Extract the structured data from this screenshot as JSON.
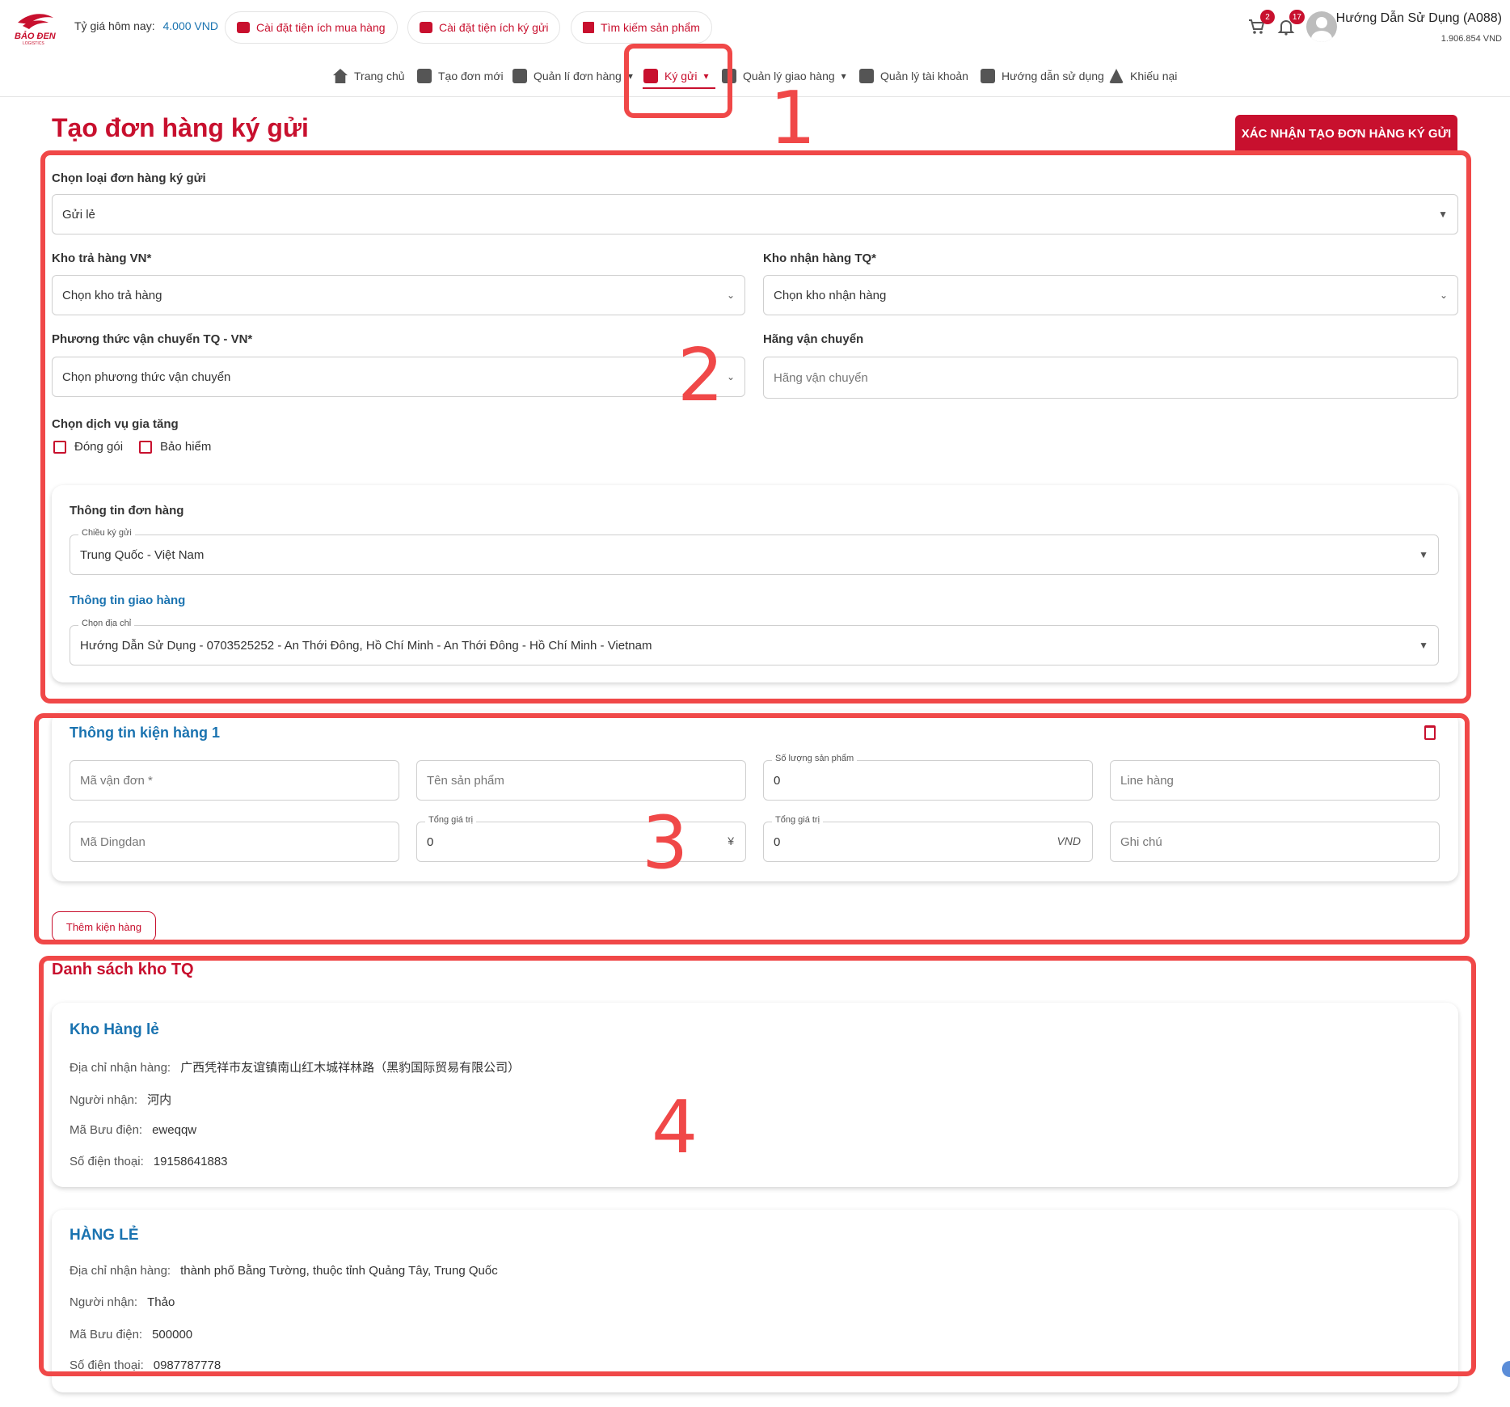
{
  "header": {
    "rate_label": "Tỷ giá hôm nay:",
    "rate_value": "4.000 VND",
    "pills": [
      {
        "label": "Cài đặt tiện ích mua hàng"
      },
      {
        "label": "Cài đặt tiện ích ký gửi"
      },
      {
        "label": "Tìm kiếm sản phẩm"
      }
    ],
    "cart_count": "2",
    "notif_count": "17",
    "user_name": "Hướng Dẫn Sử Dụng (A088)",
    "user_balance": "1.906.854 VND"
  },
  "nav": {
    "items": [
      {
        "label": "Trang chủ",
        "icon": "home-icon"
      },
      {
        "label": "Tạo đơn mới",
        "icon": "plus-square-icon"
      },
      {
        "label": "Quản lí đơn hàng",
        "icon": "cart-icon"
      },
      {
        "label": "Ký gửi",
        "icon": "box-icon"
      },
      {
        "label": "Quản lý giao hàng",
        "icon": "truck-icon"
      },
      {
        "label": "Quản lý tài khoản",
        "icon": "account-icon"
      },
      {
        "label": "Hướng dẫn sử dụng",
        "icon": "document-icon"
      },
      {
        "label": "Khiếu nại",
        "icon": "warning-icon"
      }
    ],
    "active": "Ký gửi"
  },
  "annotations": [
    "1",
    "2",
    "3",
    "4"
  ],
  "page": {
    "title": "Tạo đơn hàng ký gửi",
    "confirm_button": "XÁC NHẬN TẠO ĐƠN HÀNG KÝ GỬI"
  },
  "form": {
    "order_type_label": "Chọn loại đơn hàng ký gửi",
    "order_type_value": "Gửi lẻ",
    "vn_warehouse_label": "Kho trả hàng VN*",
    "vn_warehouse_placeholder": "Chọn kho trả hàng",
    "cn_warehouse_label": "Kho nhận hàng TQ*",
    "cn_warehouse_placeholder": "Chọn kho nhận hàng",
    "shipping_method_label": "Phương thức vận chuyển TQ - VN*",
    "shipping_method_placeholder": "Chọn phương thức vận chuyển",
    "carrier_label": "Hãng vận chuyển",
    "carrier_placeholder": "Hãng vận chuyển",
    "services_label": "Chọn dịch vụ gia tăng",
    "services": [
      "Đóng gói",
      "Bảo hiểm"
    ]
  },
  "order_info": {
    "title": "Thông tin đơn hàng",
    "direction_label": "Chiều ký gửi",
    "direction_value": "Trung Quốc - Việt Nam",
    "delivery_title": "Thông tin giao hàng",
    "address_label": "Chọn địa chỉ",
    "address_value": "Hướng Dẫn Sử Dụng - 0703525252 - An Thới Đông, Hồ Chí Minh - An Thới Đông - Hồ Chí Minh - Vietnam"
  },
  "package": {
    "title": "Thông tin kiện hàng 1",
    "tracking_placeholder": "Mã vận đơn *",
    "product_name_placeholder": "Tên sản phẩm",
    "quantity_label": "Số lượng sản phẩm",
    "quantity_value": "0",
    "line_placeholder": "Line hàng",
    "dingdan_placeholder": "Mã Dingdan",
    "total_cny_label": "Tổng giá trị",
    "total_cny_value": "0",
    "total_cny_suffix": "¥",
    "total_vnd_label": "Tổng giá trị",
    "total_vnd_value": "0",
    "total_vnd_suffix": "VND",
    "note_placeholder": "Ghi chú",
    "add_button": "Thêm kiện hàng"
  },
  "warehouses": {
    "title": "Danh sách kho TQ",
    "labels": {
      "address": "Địa chỉ nhận hàng:",
      "recipient": "Người nhận:",
      "postal": "Mã Bưu điện:",
      "phone": "Số điện thoại:"
    },
    "items": [
      {
        "name": "Kho Hàng lẻ",
        "address": "广西凭祥市友谊镇南山红木城祥林路（黑豹国际贸易有限公司）",
        "recipient": "河内",
        "postal": "eweqqw",
        "phone": "19158641883"
      },
      {
        "name": "HÀNG LẺ",
        "address": "thành phố Bằng Tường, thuộc tỉnh Quảng Tây, Trung Quốc",
        "recipient": "Thảo",
        "postal": "500000",
        "phone": "0987787778"
      }
    ]
  },
  "colors": {
    "brand_red": "#c8102e",
    "link_blue": "#1a73b0",
    "annotation_red": "#f04848"
  }
}
